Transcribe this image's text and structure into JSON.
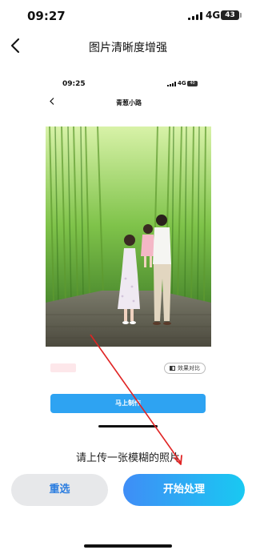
{
  "status_bar": {
    "time": "09:27",
    "network": "4G",
    "battery": "43"
  },
  "nav": {
    "title": "图片清晰度增强"
  },
  "embedded_screenshot": {
    "status_bar": {
      "time": "09:25",
      "network": "4G",
      "battery": "40"
    },
    "title": "青葱小路",
    "compare_label": "效果对比",
    "action_button": "马上制作"
  },
  "prompt": "请上传一张模糊的照片",
  "buttons": {
    "reselect": "重选",
    "start": "开始处理"
  },
  "colors": {
    "accent": "#2ea3f2",
    "start_gradient_left": "#3f8df6",
    "start_gradient_right": "#19c9f2",
    "annotation_arrow": "#e02424"
  }
}
